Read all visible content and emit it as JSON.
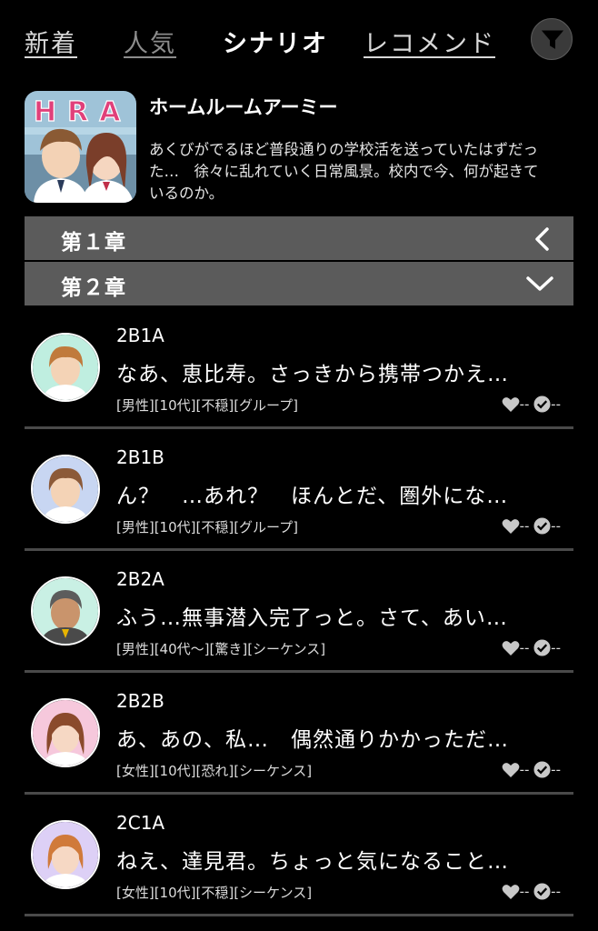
{
  "tabs": {
    "new": "新着",
    "popular": "人気",
    "scenario": "シナリオ",
    "recommend": "レコメンド"
  },
  "filter_icon": "filter-funnel-icon",
  "scenario": {
    "thumb_text": "HRA",
    "title": "ホームルームアーミー",
    "description": "あくびがでるほど普段通りの学校活を送っていたはずだった…　徐々に乱れていく日常風景。校内で今、何が起きているのか。"
  },
  "chapters": [
    {
      "label": "第１章",
      "icon": "chevron-left-icon"
    },
    {
      "label": "第２章",
      "icon": "chevron-down-icon"
    }
  ],
  "episodes": [
    {
      "code": "2B1A",
      "line": "なあ、恵比寿。さっきから携帯つかえ…",
      "tags": "[男性][10代][不穏][グループ]",
      "likes": "--",
      "plays": "--"
    },
    {
      "code": "2B1B",
      "line": "ん？　…あれ？　ほんとだ、圏外にな…",
      "tags": "[男性][10代][不穏][グループ]",
      "likes": "--",
      "plays": "--"
    },
    {
      "code": "2B2A",
      "line": "ふう…無事潜入完了っと。さて、あい…",
      "tags": "[男性][40代〜][驚き][シーケンス]",
      "likes": "--",
      "plays": "--"
    },
    {
      "code": "2B2B",
      "line": "あ、あの、私…　偶然通りかかっただ…",
      "tags": "[女性][10代][恐れ][シーケンス]",
      "likes": "--",
      "plays": "--"
    },
    {
      "code": "2C1A",
      "line": "ねえ、達見君。ちょっと気になること…",
      "tags": "[女性][10代][不穏][シーケンス]",
      "likes": "--",
      "plays": "--"
    }
  ],
  "colors": {
    "background": "#000000",
    "chapter_bar": "#5b5b5b",
    "divider": "#4a4a4a",
    "thumb_letters": "#e0407a"
  }
}
